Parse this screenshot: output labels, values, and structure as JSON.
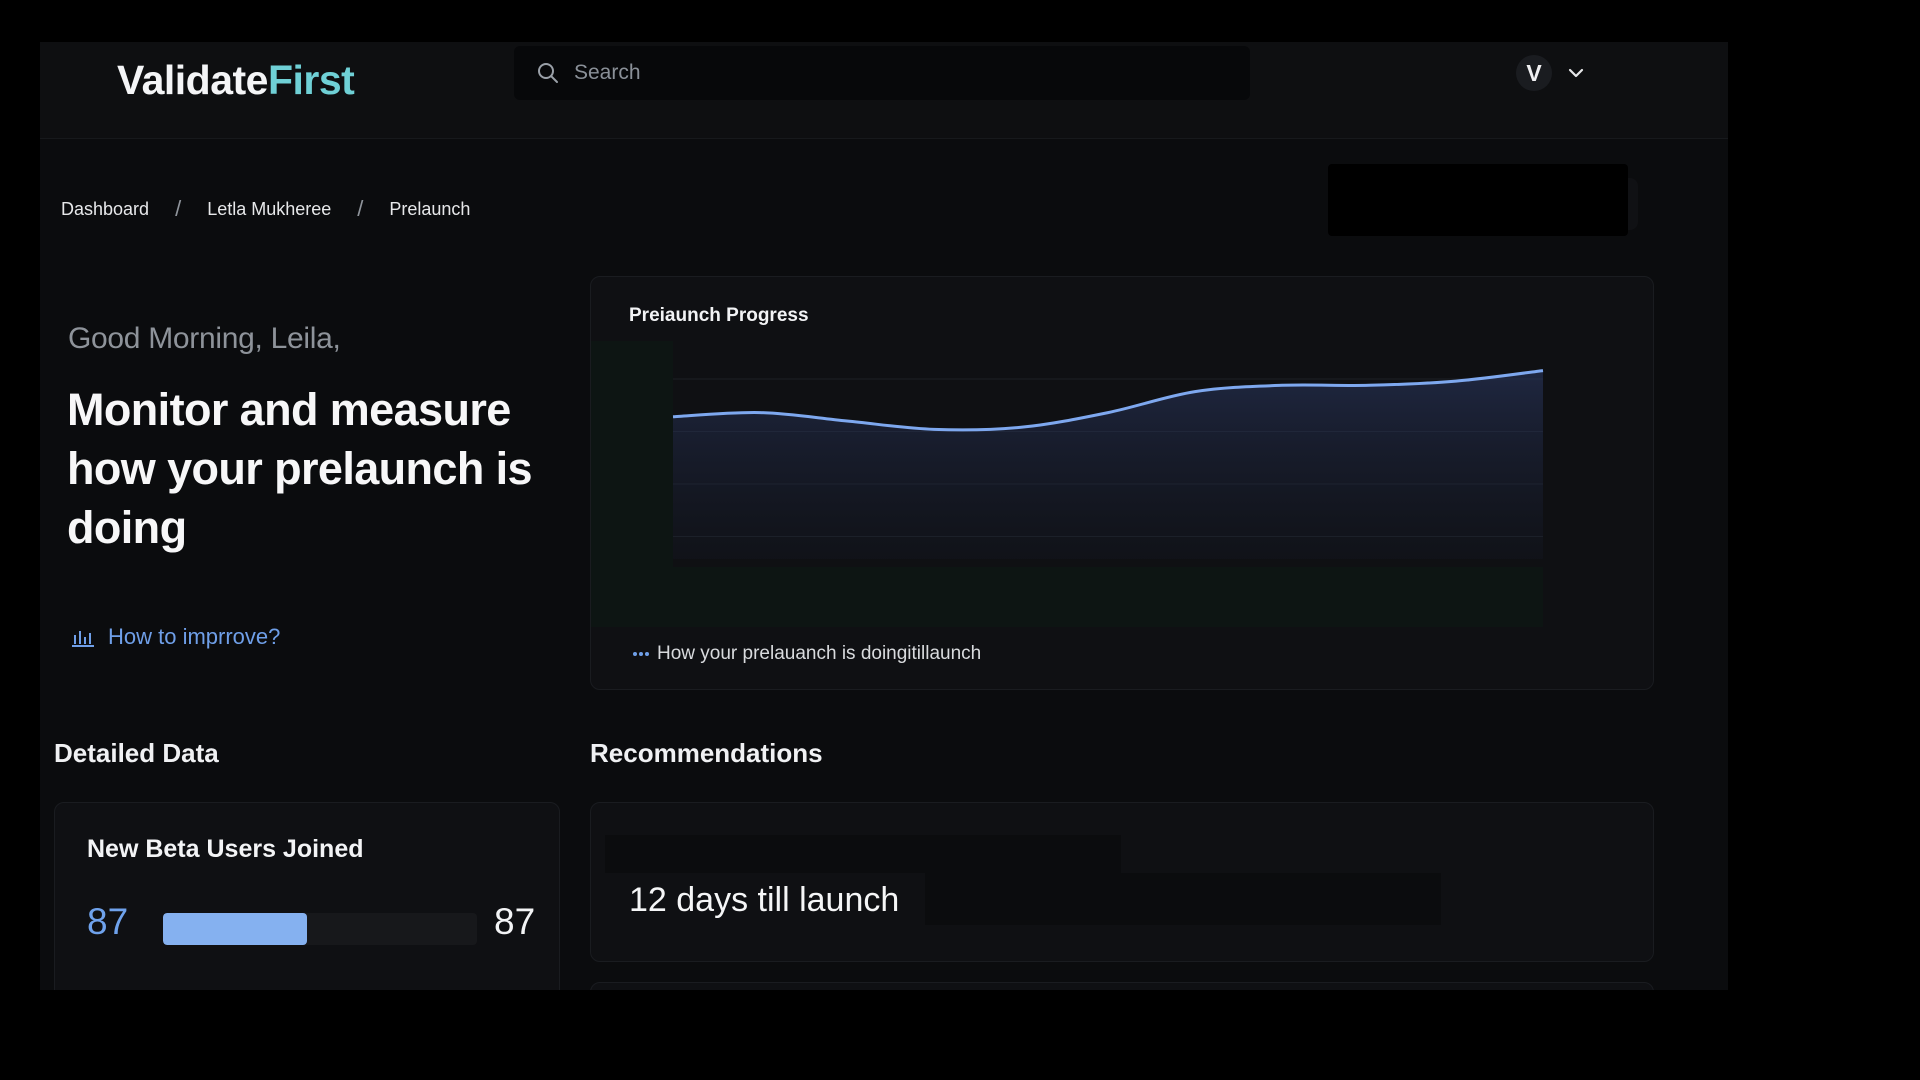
{
  "brand": {
    "part1": "Validate",
    "part2": "First"
  },
  "search": {
    "placeholder": "Search"
  },
  "user": {
    "initial": "V"
  },
  "breadcrumb": {
    "items": [
      "Dashboard",
      "Letla Mukheree",
      "Prelaunch"
    ],
    "separator": "/"
  },
  "hero": {
    "greeting": "Good Morning, Leila,",
    "headline": "Monitor and measure how your prelaunch is doing",
    "improve_link": "How to imprrove?"
  },
  "chart": {
    "title": "Preiaunch Progress",
    "legend": "How your prelauanch is doingitillaunch"
  },
  "chart_data": {
    "type": "area",
    "title": "Preiaunch Progress",
    "xlabel": "",
    "ylabel": "",
    "x": [
      0,
      1,
      2,
      3,
      4,
      5,
      6,
      7,
      8,
      9,
      10
    ],
    "series": [
      {
        "name": "How your prelauanch is doingitillaunch",
        "values": [
          62,
          64,
          60,
          56,
          57,
          64,
          74,
          77,
          77,
          79,
          84
        ]
      }
    ],
    "ylim": [
      0,
      100
    ],
    "grid": true,
    "legend_position": "bottom-left"
  },
  "sections": {
    "detailed": "Detailed Data",
    "recommendations": "Recommendations"
  },
  "stat": {
    "title": "New Beta Users Joined",
    "value_left": "87",
    "value_right": "87",
    "progress": 0.46
  },
  "recommendation": {
    "text": "12 days till launch"
  },
  "colors": {
    "accent": "#6fa2ec",
    "brand_second": "#6fd0d6",
    "line": "#7ea8ef"
  },
  "icons": {
    "search": "search-icon",
    "chevron": "chevron-down-icon",
    "improve": "bar-chart-icon"
  }
}
